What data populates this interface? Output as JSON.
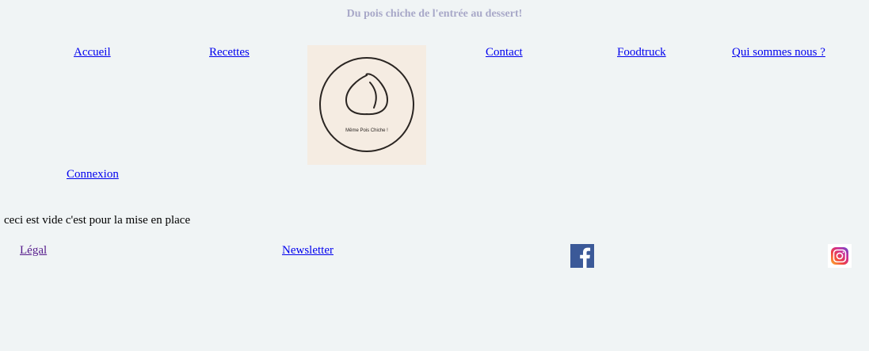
{
  "header": {
    "tagline": "Du pois chiche de l'entrée au dessert!"
  },
  "nav": {
    "accueil": "Accueil",
    "recettes": "Recettes",
    "contact": "Contact",
    "foodtruck": "Foodtruck",
    "qui_sommes_nous": "Qui sommes nous ?",
    "connexion": "Connexion"
  },
  "logo": {
    "brand_text": "Même Pois Chiche !",
    "background_color": "#f5ece2"
  },
  "main": {
    "placeholder_text": "ceci est vide c'est pour la mise en place"
  },
  "footer": {
    "legal": "Légal",
    "newsletter": "Newsletter",
    "facebook_icon": "facebook-icon",
    "instagram_icon": "instagram-icon"
  },
  "colors": {
    "background": "#f0f4f5",
    "tagline": "#a8a8c8",
    "link": "#0000ee",
    "visited_link": "#551a8b",
    "facebook": "#3b5998"
  }
}
